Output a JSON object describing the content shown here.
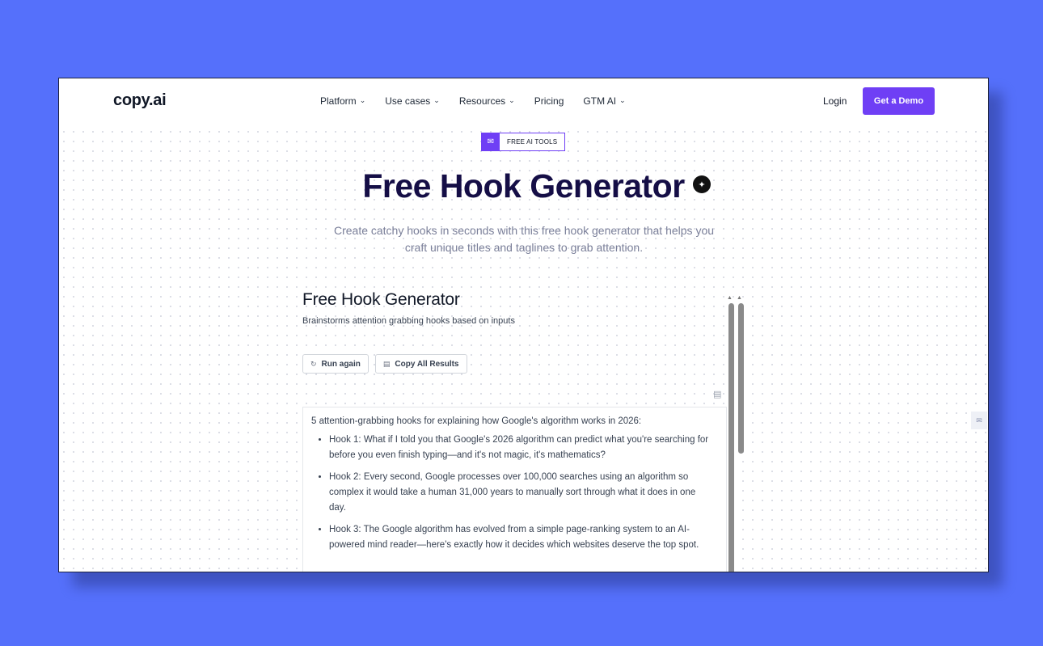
{
  "nav": {
    "logo": "copy.ai",
    "links": [
      {
        "label": "Platform",
        "has_dropdown": true
      },
      {
        "label": "Use cases",
        "has_dropdown": true
      },
      {
        "label": "Resources",
        "has_dropdown": true
      },
      {
        "label": "Pricing",
        "has_dropdown": false
      },
      {
        "label": "GTM AI",
        "has_dropdown": true
      }
    ],
    "login": "Login",
    "cta": "Get a Demo"
  },
  "badge": {
    "icon": "megaphone-icon",
    "label": "FREE AI TOOLS"
  },
  "hero": {
    "title": "Free Hook Generator",
    "subtitle": "Create catchy hooks in seconds with this free hook generator that helps you craft unique titles and taglines to grab attention."
  },
  "tool": {
    "title": "Free Hook Generator",
    "description": "Brainstorms attention grabbing hooks based on inputs",
    "run_again": "Run again",
    "copy_all": "Copy All Results",
    "results_heading": "5 attention-grabbing hooks for explaining how Google's algorithm works in 2026:",
    "hooks": [
      "Hook 1: What if I told you that Google's 2026 algorithm can predict what you're searching for before you even finish typing—and it's not magic, it's mathematics?",
      "Hook 2: Every second, Google processes over 100,000 searches using an algorithm so complex it would take a human 31,000 years to manually sort through what it does in one day.",
      "Hook 3: The Google algorithm has evolved from a simple page-ranking system to an AI-powered mind reader—here's exactly how it decides which websites deserve the top spot."
    ]
  },
  "colors": {
    "background": "#5570fb",
    "accent": "#6f3ff5",
    "title": "#150e46"
  }
}
